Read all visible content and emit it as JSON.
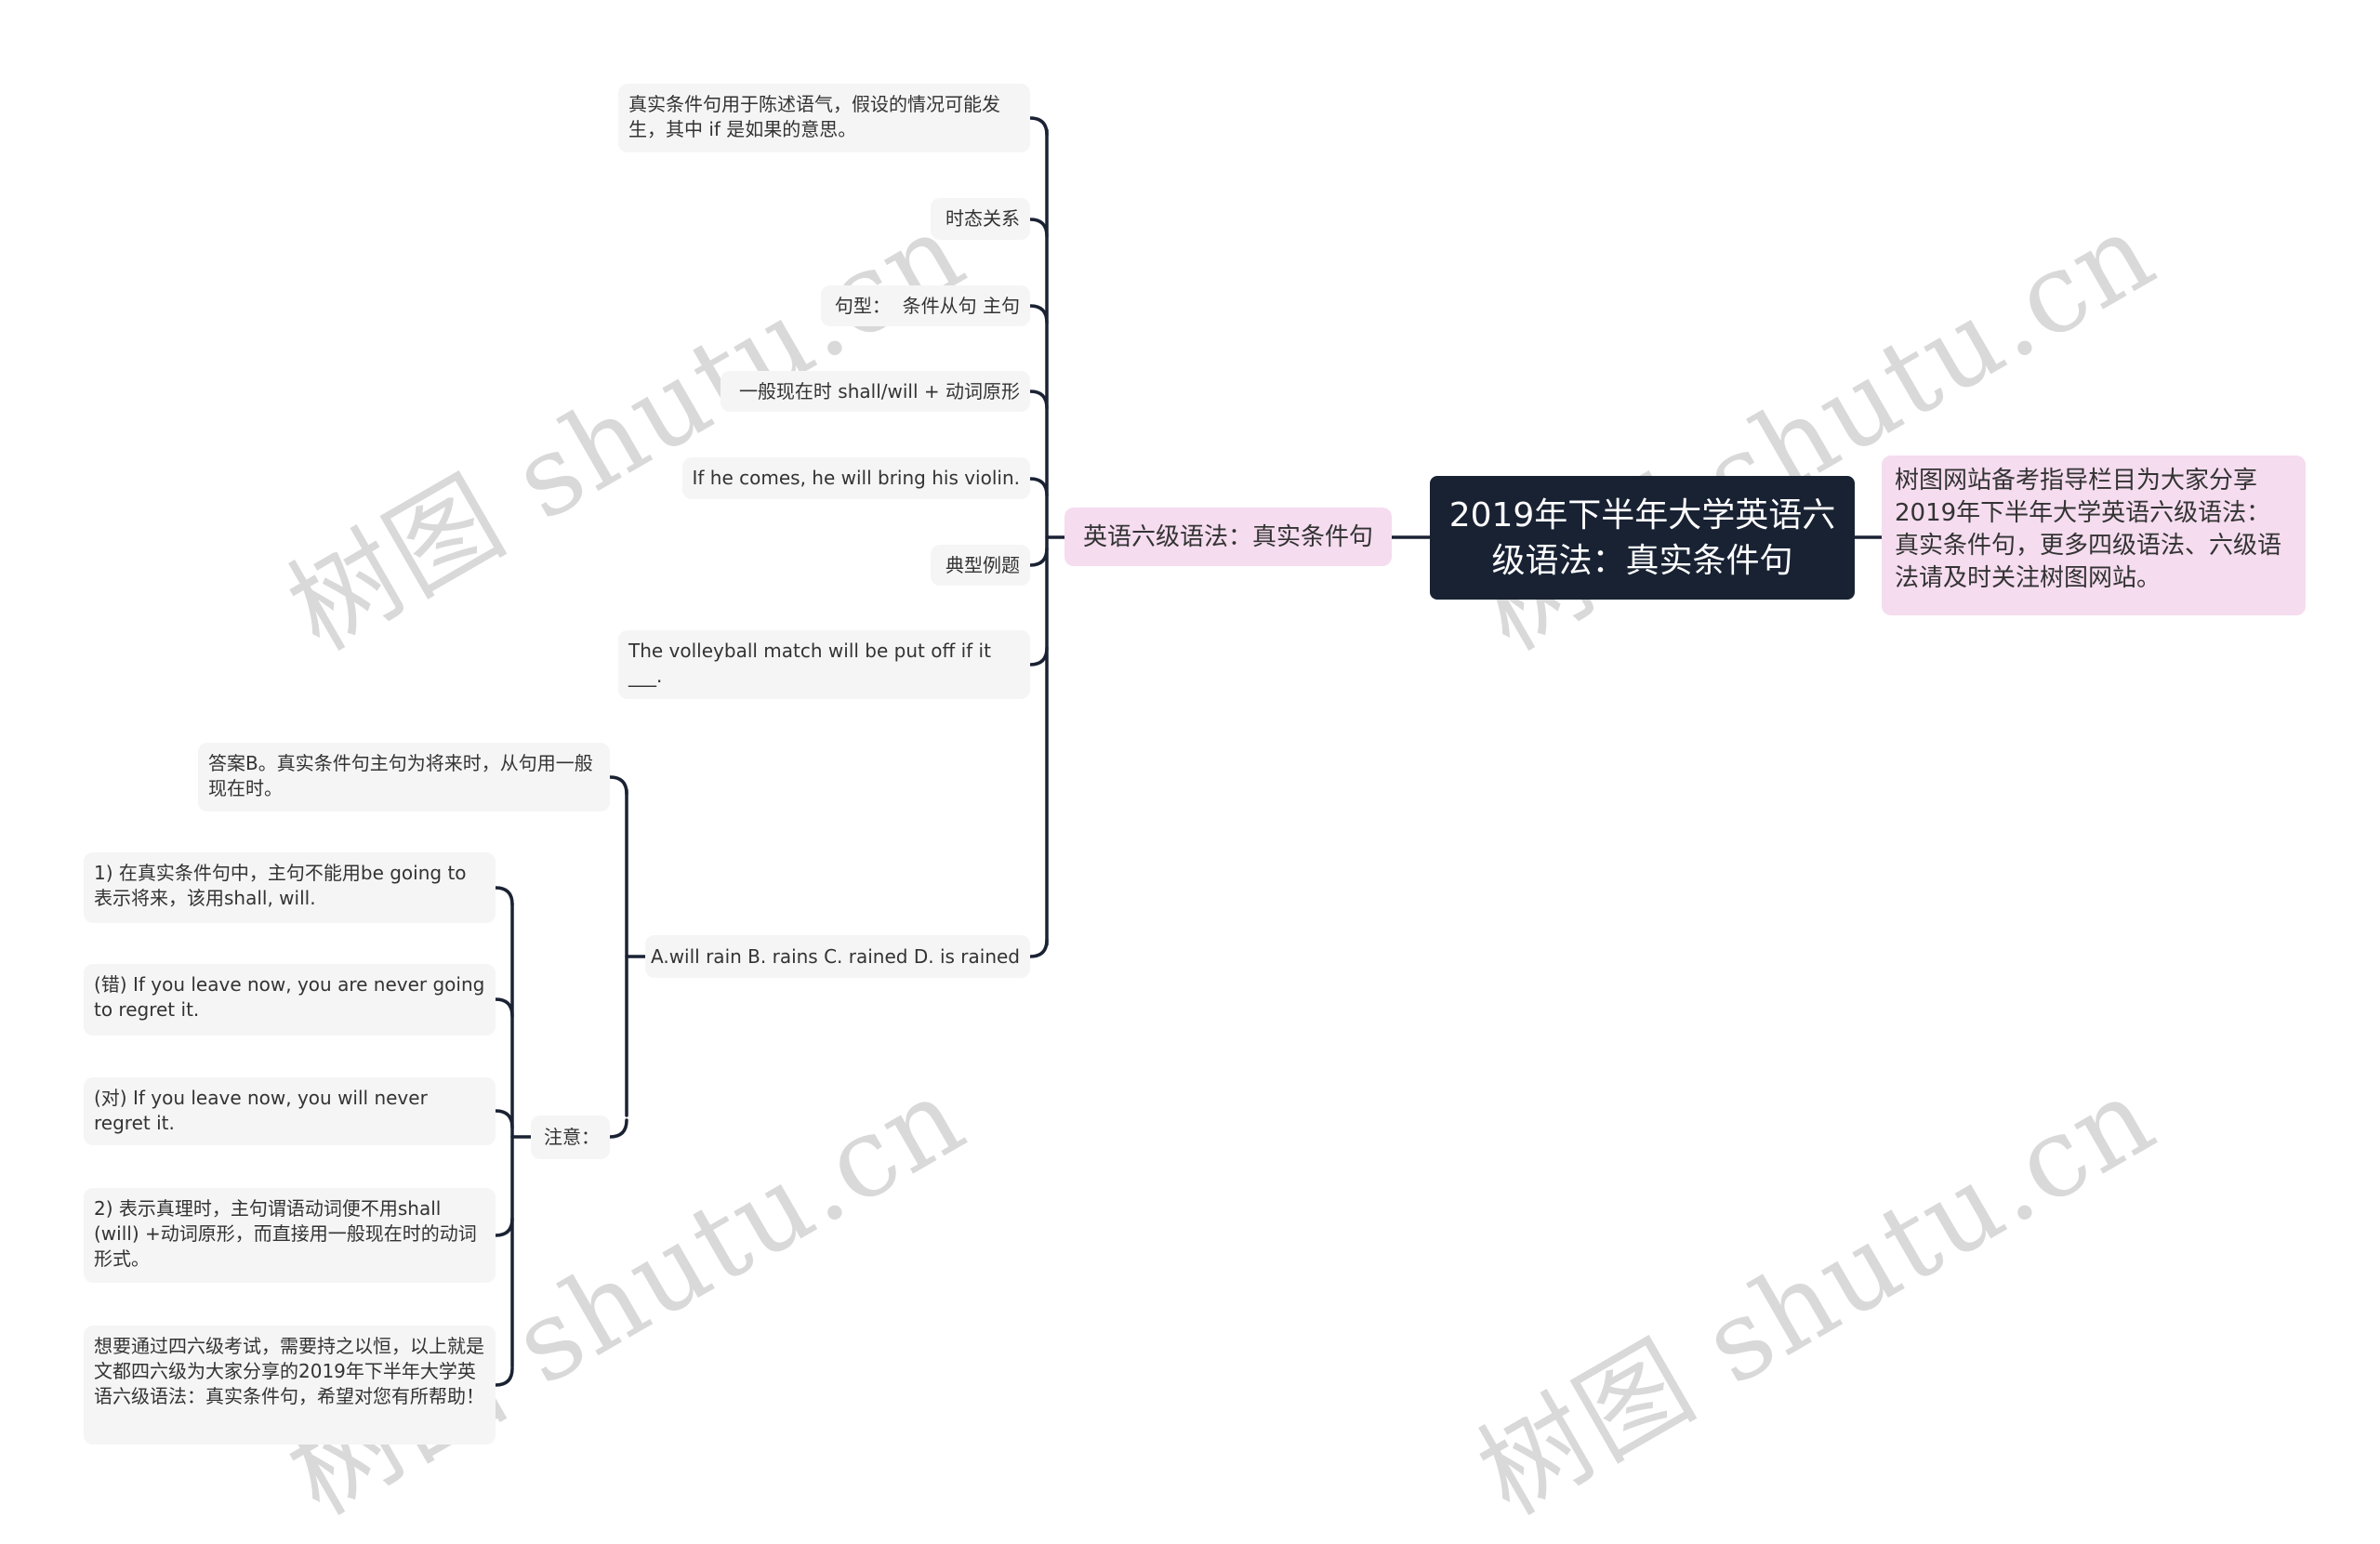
{
  "watermark": "树图 shutu.cn",
  "colors": {
    "root_bg": "#182233",
    "branch_bg": "#f5dcef",
    "leaf_bg": "#f5f5f5",
    "line": "#1a2233",
    "watermark": "#d9d9d9"
  },
  "root": {
    "title": "2019年下半年大学英语六级语法：真实条件句"
  },
  "note": {
    "text": "树图网站备考指导栏目为大家分享2019年下半年大学英语六级语法：真实条件句，更多四级语法、六级语法请及时关注树图网站。"
  },
  "branch": {
    "label": "英语六级语法：真实条件句",
    "children": [
      {
        "text": "真实条件句用于陈述语气，假设的情况可能发生，其中 if 是如果的意思。"
      },
      {
        "text": "时态关系"
      },
      {
        "text": "句型：  条件从句 主句"
      },
      {
        "text": "一般现在时 shall/will + 动词原形"
      },
      {
        "text": "If he comes, he will bring his violin."
      },
      {
        "text": "典型例题"
      },
      {
        "text": "The volleyball match will be put off if it ___."
      },
      {
        "text": "A.will rain B. rains C. rained D. is rained"
      }
    ]
  },
  "answer_group": {
    "answer": "答案B。真实条件句主句为将来时，从句用一般现在时。",
    "notice_label": "注意：",
    "notice_items": [
      {
        "text": "1) 在真实条件句中，主句不能用be going to 表示将来，该用shall, will."
      },
      {
        "text": "(错) If you leave now, you are never going to regret it."
      },
      {
        "text": "(对) If you leave now, you will never regret it."
      },
      {
        "text": "2) 表示真理时，主句谓语动词便不用shall (will) +动词原形，而直接用一般现在时的动词形式。"
      },
      {
        "text": "想要通过四六级考试，需要持之以恒，以上就是文都四六级为大家分享的2019年下半年大学英语六级语法：真实条件句，希望对您有所帮助！"
      }
    ]
  }
}
